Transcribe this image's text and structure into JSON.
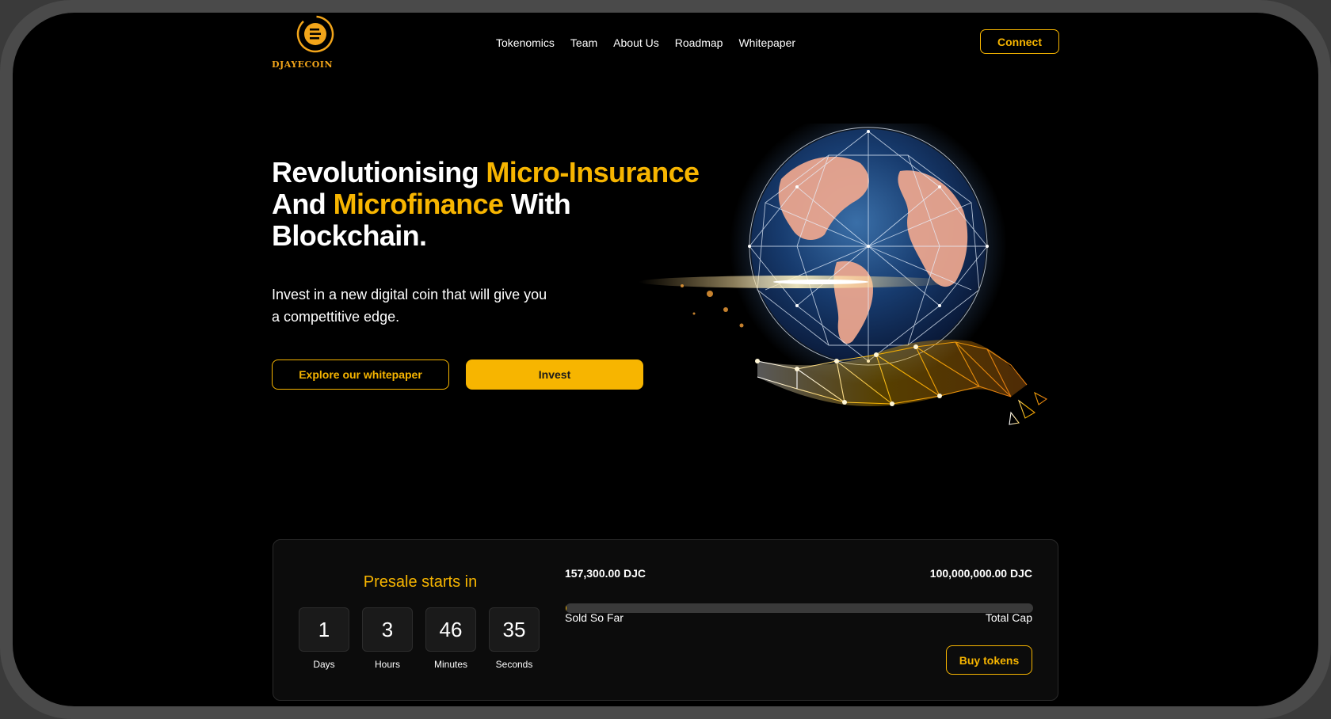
{
  "brand": {
    "name": "DJAYECOIN",
    "accent_color": "#f7b500"
  },
  "nav": {
    "items": [
      {
        "label": "Tokenomics"
      },
      {
        "label": "Team"
      },
      {
        "label": "About Us"
      },
      {
        "label": "Roadmap"
      },
      {
        "label": "Whitepaper"
      }
    ],
    "connect_label": "Connect"
  },
  "hero": {
    "title_part1": "Revolutionising ",
    "title_accent1": "Micro-Insurance",
    "title_part2": "And ",
    "title_accent2": "Microfinance",
    "title_part3": " With",
    "title_part4": "Blockchain.",
    "subtitle_line1": "Invest in a new digital coin that will give you",
    "subtitle_line2": "a compettitive edge.",
    "whitepaper_button": "Explore our whitepaper",
    "invest_button": "Invest"
  },
  "presale": {
    "title": "Presale starts in",
    "countdown": [
      {
        "value": "1",
        "label": "Days"
      },
      {
        "value": "3",
        "label": "Hours"
      },
      {
        "value": "46",
        "label": "Minutes"
      },
      {
        "value": "35",
        "label": "Seconds"
      }
    ],
    "sold_amount": "157,300.00 DJC",
    "total_cap": "100,000,000.00 DJC",
    "sold_label": "Sold So Far",
    "cap_label": "Total Cap",
    "progress_fraction": 0.001573,
    "buy_button": "Buy tokens"
  }
}
